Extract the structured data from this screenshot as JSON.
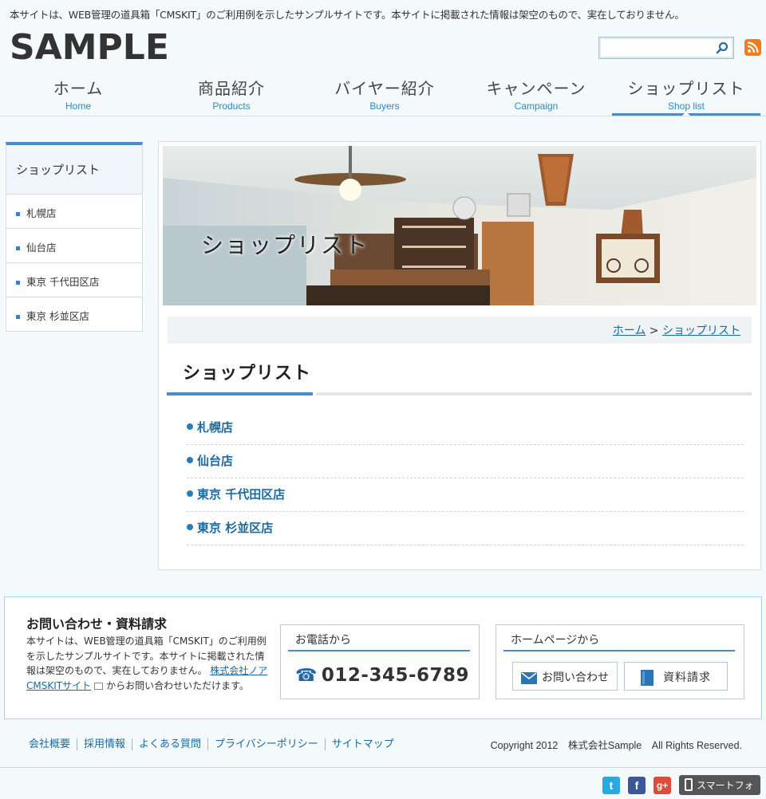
{
  "header": {
    "notice": "本サイトは、WEB管理の道具箱「CMSKIT」のご利用例を示したサンプルサイトです。本サイトに掲載された情報は架空のもので、実在しておりません。",
    "logo": "SAMPLE",
    "search_placeholder": ""
  },
  "nav": [
    {
      "jp": "ホーム",
      "en": "Home"
    },
    {
      "jp": "商品紹介",
      "en": "Products"
    },
    {
      "jp": "バイヤー紹介",
      "en": "Buyers"
    },
    {
      "jp": "キャンペーン",
      "en": "Campaign"
    },
    {
      "jp": "ショップリスト",
      "en": "Shop list"
    }
  ],
  "sidebar": {
    "title": "ショップリスト",
    "items": [
      "札幌店",
      "仙台店",
      "東京 千代田区店",
      "東京 杉並区店"
    ]
  },
  "main": {
    "banner_title": "ショップリスト",
    "breadcrumb": {
      "home": "ホーム",
      "sep": " > ",
      "current": "ショップリスト"
    },
    "page_title": "ショップリスト",
    "shops": [
      "札幌店",
      "仙台店",
      "東京 千代田区店",
      "東京 杉並区店"
    ]
  },
  "contact": {
    "title": "お問い合わせ・資料請求",
    "text1": "本サイトは、WEB管理の道具箱「CMSKIT」のご利用例を示したサンプルサイトです。本サイトに掲載された情報は架空のもので、実在しておりません。",
    "link": "株式会社ノア CMSKITサイト",
    "text2": "からお問い合わせいただけます。",
    "phone_title": "お電話から",
    "phone": "012-345-6789",
    "web_title": "ホームページから",
    "inquiry_btn": "お問い合わせ",
    "docs_btn": "資料請求"
  },
  "footer": {
    "links": [
      "会社概要",
      "採用情報",
      "よくある質問",
      "プライバシーポリシー",
      "サイトマップ"
    ],
    "copyright": "Copyright 2012　株式会社Sample　All Rights Reserved.",
    "smartphone": "スマートフォン"
  },
  "colors": {
    "accent": "#4a8cc8",
    "link": "#1a6aa0",
    "rss": "#f07c1d",
    "twitter": "#2aa9e0",
    "facebook": "#3b5998",
    "gplus": "#dd4b39"
  }
}
